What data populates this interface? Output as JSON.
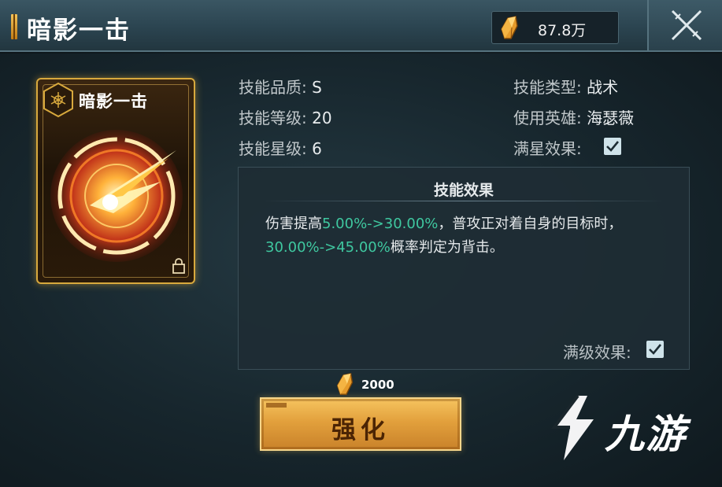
{
  "header": {
    "title": "暗影一击",
    "currency_value": "87.8万",
    "currency_icon": "gold-crystal-icon",
    "close_icon": "close-x-icon"
  },
  "card": {
    "name": "暗影一击",
    "emblem_icon": "hexagon-emblem-icon",
    "art_icon": "shadow-strike-art",
    "lock_icon": "lock-icon"
  },
  "stats": {
    "quality_label": "技能品质:",
    "quality_value": "S",
    "level_label": "技能等级:",
    "level_value": "20",
    "star_label": "技能星级:",
    "star_value": "6",
    "type_label": "技能类型:",
    "type_value": "战术",
    "hero_label": "使用英雄:",
    "hero_value": "海瑟薇",
    "fullstar_label": "满星效果:",
    "fullstar_checked": true
  },
  "effect": {
    "title": "技能效果",
    "line1_a": "伤害提高",
    "line1_hl": "5.00%->30.00%",
    "line1_b": "，普攻正对着自身的目标时，",
    "line2_hl": "30.00%->45.00%",
    "line2_b": "概率判定为背击。",
    "maxlevel_label": "满级效果:",
    "maxlevel_checked": true
  },
  "upgrade": {
    "cost": "2000",
    "label": "强化"
  },
  "watermark": {
    "text": "九游"
  },
  "colors": {
    "highlight": "#3fc8a0",
    "gold": "#e2a03c"
  }
}
